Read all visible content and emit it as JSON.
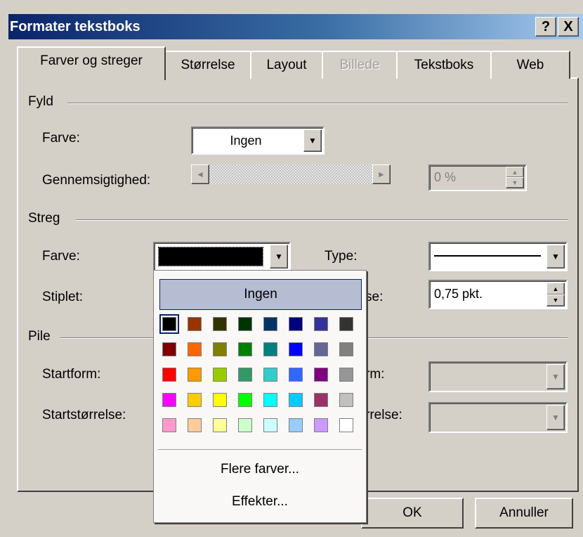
{
  "window": {
    "title": "Formater tekstboks",
    "help_glyph": "?",
    "close_glyph": "X"
  },
  "tabs": [
    "Farver og streger",
    "Størrelse",
    "Layout",
    "Billede",
    "Tekstboks",
    "Web"
  ],
  "fill": {
    "legend": "Fyld",
    "color_label": "Farve:",
    "color_value": "Ingen",
    "transparency_label": "Gennemsigtighed:",
    "transparency_value": "0 %"
  },
  "line": {
    "legend": "Streg",
    "color_label": "Farve:",
    "color_value": "#000000",
    "type_label": "Type:",
    "dashed_label": "Stiplet:",
    "weight_label_partial": "se:",
    "weight_value": "0,75 pkt."
  },
  "arrows": {
    "legend": "Pile",
    "start_form_label": "Startform:",
    "end_form_label_partial": "rm:",
    "start_size_label": "Startstørrelse:",
    "end_size_label_partial": "rrelse:"
  },
  "popup": {
    "none_label": "Ingen",
    "more_colors": "Flere farver...",
    "effects": "Effekter...",
    "palette": [
      [
        "#000000",
        "#993300",
        "#333300",
        "#003300",
        "#003366",
        "#000080",
        "#333399",
        "#333333"
      ],
      [
        "#800000",
        "#ff6600",
        "#808000",
        "#008000",
        "#008080",
        "#0000ff",
        "#666699",
        "#808080"
      ],
      [
        "#ff0000",
        "#ff9900",
        "#99cc00",
        "#339966",
        "#33cccc",
        "#3366ff",
        "#800080",
        "#969696"
      ],
      [
        "#ff00ff",
        "#ffcc00",
        "#ffff00",
        "#00ff00",
        "#00ffff",
        "#00ccff",
        "#993366",
        "#c0c0c0"
      ],
      [
        "#ff99cc",
        "#ffcc99",
        "#ffff99",
        "#ccffcc",
        "#ccffff",
        "#99ccff",
        "#cc99ff",
        "#ffffff"
      ]
    ]
  },
  "buttons": {
    "ok": "OK",
    "cancel": "Annuller"
  }
}
